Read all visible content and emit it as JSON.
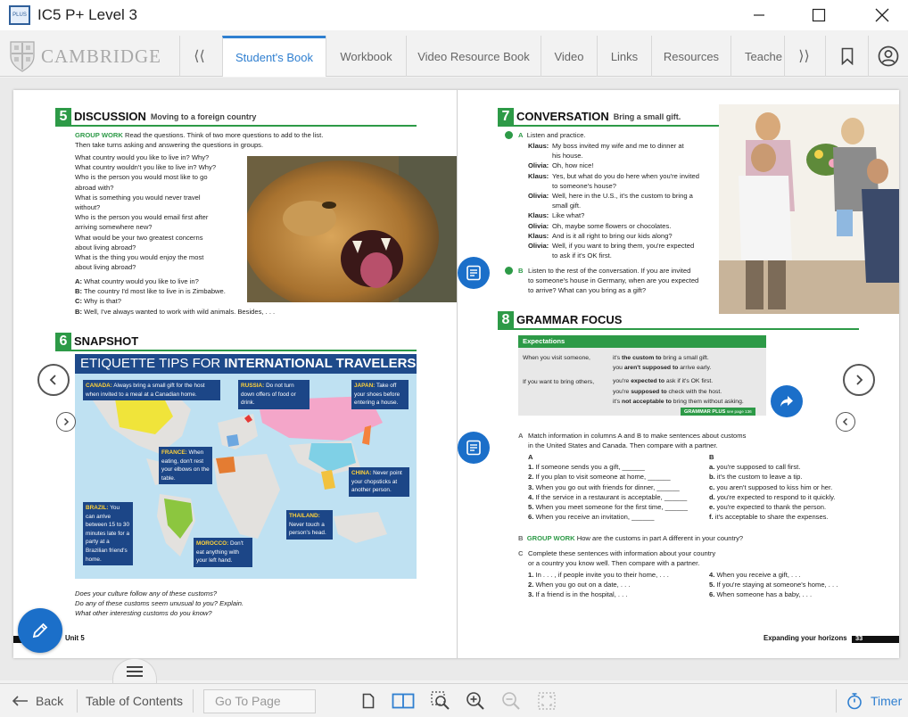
{
  "window": {
    "title": "IC5 P+ Level 3",
    "icon_text": "PLUS"
  },
  "nav": {
    "logo_text": "CAMBRIDGE",
    "back_arrow": "⟨⟨",
    "forward_arrow": "⟩⟩",
    "tabs": [
      {
        "label": "Student's Book",
        "active": true
      },
      {
        "label": "Workbook"
      },
      {
        "label": "Video Resource Book"
      },
      {
        "label": "Video"
      },
      {
        "label": "Links"
      },
      {
        "label": "Resources"
      },
      {
        "label": "Teache"
      }
    ]
  },
  "left_page": {
    "s5": {
      "num": "5",
      "title": "DISCUSSION",
      "subtitle": "Moving to a foreign country",
      "group_work": "GROUP WORK",
      "intro_1": "Read the questions. Think of two more questions to add to the list.",
      "intro_2": "Then take turns asking and answering the questions in groups.",
      "questions": [
        "What country would you like to live in? Why?",
        "What country wouldn't you like to live in? Why?",
        "Who is the person you would most like to go",
        "abroad with?",
        "What is something you would never travel",
        "without?",
        "Who is the person you would email first after",
        "arriving somewhere new?",
        "What would be your two greatest concerns",
        "about living abroad?",
        "What is the thing you would enjoy the most",
        "about living abroad?"
      ],
      "dialog": [
        {
          "sp": "A:",
          "t": "What country would you like to live in?"
        },
        {
          "sp": "B:",
          "t": "The country I'd most like to live in is Zimbabwe."
        },
        {
          "sp": "C:",
          "t": "Why is that?"
        },
        {
          "sp": "B:",
          "t": "Well, I've always wanted to work with wild animals. Besides, . . ."
        }
      ]
    },
    "s6": {
      "num": "6",
      "title": "SNAPSHOT",
      "map_title_a": "ETIQUETTE TIPS FOR ",
      "map_title_b": "INTERNATIONAL TRAVELERS",
      "tips": [
        {
          "country": "CANADA:",
          "text": "Always bring a small gift for the host when invited to a meal at a Canadian home."
        },
        {
          "country": "RUSSIA:",
          "text": "Do not turn down offers of food or drink."
        },
        {
          "country": "JAPAN:",
          "text": "Take off your shoes before entering a house."
        },
        {
          "country": "FRANCE:",
          "text": "When eating, don't rest your elbows on the table."
        },
        {
          "country": "CHINA:",
          "text": "Never point your chopsticks at another person."
        },
        {
          "country": "BRAZIL:",
          "text": "You can arrive between 15 to 30 minutes late for a party at a Brazilian friend's home."
        },
        {
          "country": "THAILAND:",
          "text": "Never touch a person's head."
        },
        {
          "country": "MOROCCO:",
          "text": "Don't eat anything with your left hand."
        }
      ],
      "questions": [
        "Does your culture follow any of these customs?",
        "Do any of these customs seem unusual to you? Explain.",
        "What other interesting customs do you know?"
      ]
    },
    "footer": "Unit 5"
  },
  "right_page": {
    "s7": {
      "num": "7",
      "title": "CONVERSATION",
      "subtitle": "Bring a small gift.",
      "a_label": "A",
      "a_text": "Listen and practice.",
      "dialog": [
        {
          "sp": "Klaus:",
          "t": "My boss invited my wife and me to dinner at",
          "t2": "his house."
        },
        {
          "sp": "Olivia:",
          "t": "Oh, how nice!"
        },
        {
          "sp": "Klaus:",
          "t": "Yes, but what do you do here when you're invited",
          "t2": "to someone's house?"
        },
        {
          "sp": "Olivia:",
          "t": "Well, here in the U.S., it's the custom to bring a",
          "t2": "small gift."
        },
        {
          "sp": "Klaus:",
          "t": "Like what?"
        },
        {
          "sp": "Olivia:",
          "t": "Oh, maybe some flowers or chocolates."
        },
        {
          "sp": "Klaus:",
          "t": "And is it all right to bring our kids along?"
        },
        {
          "sp": "Olivia:",
          "t": "Well, if you want to bring them, you're expected",
          "t2": "to ask if it's OK first."
        }
      ],
      "b_label": "B",
      "b_text": [
        "Listen to the rest of the conversation. If you are invited",
        "to someone's house in Germany, when are you expected",
        "to arrive? What can you bring as a gift?"
      ]
    },
    "s8": {
      "num": "8",
      "title": "GRAMMAR FOCUS",
      "exp_title": "Expectations",
      "exp_rows": [
        {
          "left": "When you visit someone,",
          "pre": "it's ",
          "bold": "the custom to",
          "post": " bring a small gift."
        },
        {
          "left": "",
          "pre": "you ",
          "bold": "aren't supposed to",
          "post": " arrive early."
        },
        {
          "left": "If you want to bring others,",
          "pre": "you're ",
          "bold": "expected to",
          "post": " ask if it's OK first."
        },
        {
          "left": "",
          "pre": "you're ",
          "bold": "supposed to",
          "post": " check with the host."
        },
        {
          "left": "",
          "pre": "it's ",
          "bold": "not acceptable to",
          "post": " bring them without asking."
        }
      ],
      "grammar_plus": "GRAMMAR PLUS",
      "grammar_plus_page": "see page 136",
      "a_label": "A",
      "a_text": [
        "Match information in columns A and B to make sentences about customs",
        "in the United States and Canada. Then compare with a partner."
      ],
      "col_a_head": "A",
      "col_b_head": "B",
      "col_a": [
        {
          "n": "1.",
          "t": "If someone sends you a gift, ______"
        },
        {
          "n": "2.",
          "t": "If you plan to visit someone at home, ______"
        },
        {
          "n": "3.",
          "t": "When you go out with friends for dinner, ______"
        },
        {
          "n": "4.",
          "t": "If the service in a restaurant is acceptable, ______"
        },
        {
          "n": "5.",
          "t": "When you meet someone for the first time, ______"
        },
        {
          "n": "6.",
          "t": "When you receive an invitation, ______"
        }
      ],
      "col_b": [
        {
          "n": "a.",
          "t": "you're supposed to call first."
        },
        {
          "n": "b.",
          "t": "it's the custom to leave a tip."
        },
        {
          "n": "c.",
          "t": "you aren't supposed to kiss him or her."
        },
        {
          "n": "d.",
          "t": "you're expected to respond to it quickly."
        },
        {
          "n": "e.",
          "t": "you're expected to thank the person."
        },
        {
          "n": "f.",
          "t": "it's acceptable to share the expenses."
        }
      ],
      "b_label": "B",
      "b_group": "GROUP WORK",
      "b_text": "How are the customs in part A different in your country?",
      "c_label": "C",
      "c_text": [
        "Complete these sentences with information about your country",
        "or a country you know well. Then compare with a partner."
      ],
      "c_col_a": [
        {
          "n": "1.",
          "t": "In . . . , if people invite you to their home, . . ."
        },
        {
          "n": "2.",
          "t": "When you go out on a date, . . ."
        },
        {
          "n": "3.",
          "t": "If a friend is in the hospital, . . ."
        }
      ],
      "c_col_b": [
        {
          "n": "4.",
          "t": "When you receive a gift, . . ."
        },
        {
          "n": "5.",
          "t": "If you're staying at someone's home, . . ."
        },
        {
          "n": "6.",
          "t": "When someone has a baby, . . ."
        }
      ]
    },
    "footer_text": "Expanding your horizons",
    "footer_num": "33"
  },
  "bottom": {
    "back": "Back",
    "toc": "Table of Contents",
    "goto_placeholder": "Go To Page",
    "timer": "Timer"
  },
  "colors": {
    "accent_blue": "#1b6fc9",
    "tab_blue": "#2f7fd0",
    "book_green": "#2d9a47",
    "map_navy": "#1c4687"
  }
}
